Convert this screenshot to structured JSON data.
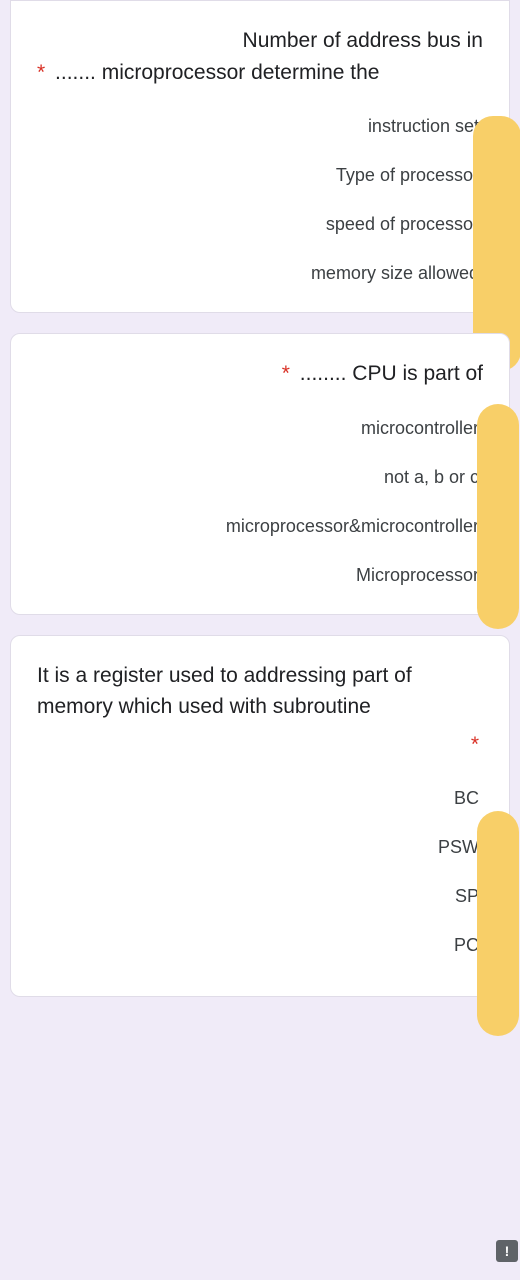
{
  "questions": [
    {
      "required": "*",
      "text": "Number of address bus in ....... microprocessor determine the",
      "options": [
        "instruction set",
        "Type of processor",
        "speed of processor",
        "memory size allowed"
      ]
    },
    {
      "required": "*",
      "text": "........ CPU is part of",
      "options": [
        "microcontroller",
        "not a, b or c",
        "microprocessor&microcontroller",
        "Microprocessor"
      ]
    },
    {
      "required": "*",
      "text": "It is a register used to addressing part of memory which used with subroutine",
      "options": [
        "BC",
        "PSW",
        "SP",
        "PC"
      ]
    }
  ],
  "alert_icon": "!"
}
